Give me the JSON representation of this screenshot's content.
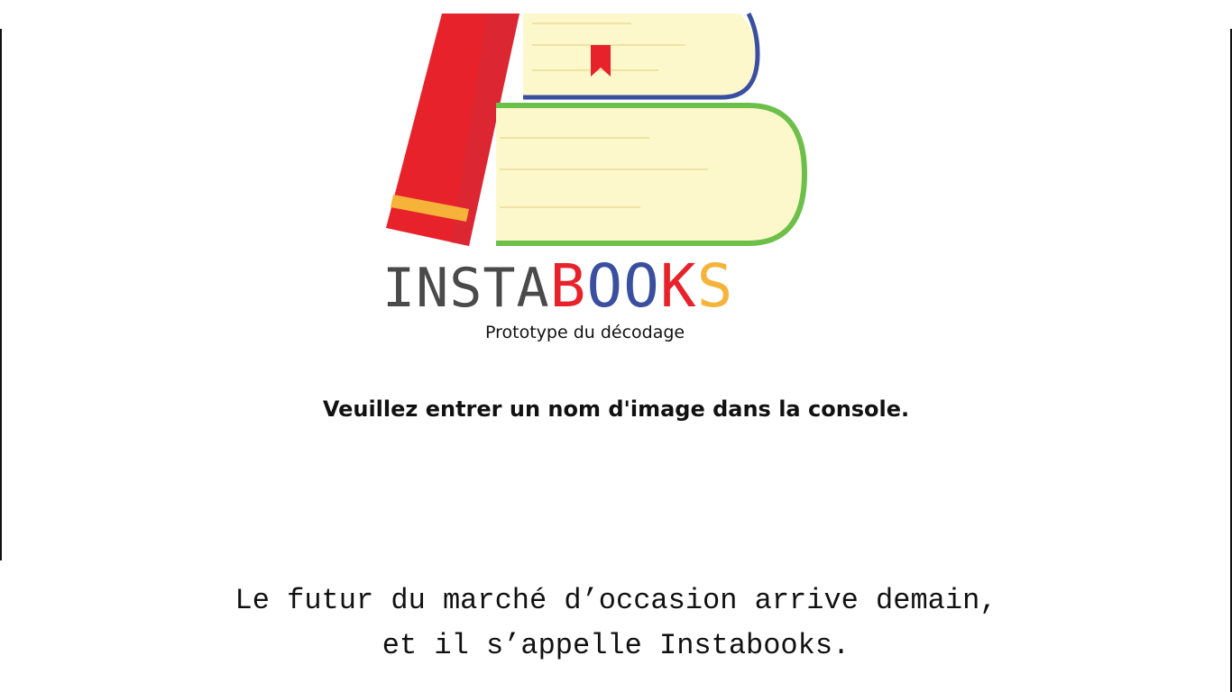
{
  "logo": {
    "wordmark_insta": "INSTA",
    "wordmark_b": "B",
    "wordmark_o1": "O",
    "wordmark_o2": "O",
    "wordmark_k": "K",
    "wordmark_s": "S",
    "subtitle": "Prototype du décodage",
    "colors": {
      "red": "#e8222b",
      "yellow": "#f5b33a",
      "blue": "#3a4fa0",
      "green": "#6cc04a",
      "page": "#fdf8cc",
      "gray": "#4a4a4a"
    }
  },
  "main": {
    "instruction": "Veuillez entrer un nom d'image dans la console."
  },
  "tagline": {
    "line1": "Le futur du marché d’occasion arrive demain,",
    "line2": "et il s’appelle Instabooks."
  }
}
